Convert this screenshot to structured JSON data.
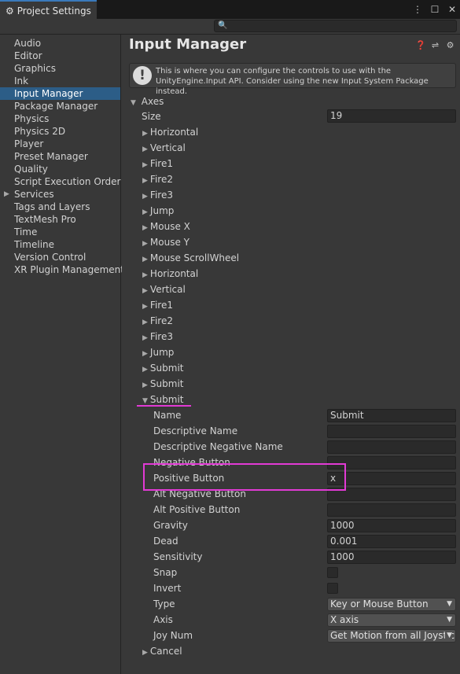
{
  "window": {
    "tab_label": "Project Settings",
    "tab_icon": "gear-icon"
  },
  "search": {
    "placeholder": ""
  },
  "sidebar": {
    "items": [
      {
        "label": "Audio"
      },
      {
        "label": "Editor"
      },
      {
        "label": "Graphics"
      },
      {
        "label": "Ink"
      },
      {
        "label": "Input Manager",
        "selected": true
      },
      {
        "label": "Package Manager"
      },
      {
        "label": "Physics"
      },
      {
        "label": "Physics 2D"
      },
      {
        "label": "Player"
      },
      {
        "label": "Preset Manager"
      },
      {
        "label": "Quality"
      },
      {
        "label": "Script Execution Order"
      },
      {
        "label": "Services",
        "expandable": true
      },
      {
        "label": "Tags and Layers"
      },
      {
        "label": "TextMesh Pro"
      },
      {
        "label": "Time"
      },
      {
        "label": "Timeline"
      },
      {
        "label": "Version Control"
      },
      {
        "label": "XR Plugin Management"
      }
    ]
  },
  "main": {
    "title": "Input Manager",
    "help_text": "This is where you can configure the controls to use with the UnityEngine.Input API. Consider using the new Input System Package instead.",
    "axes_label": "Axes",
    "size_label": "Size",
    "size_value": "19",
    "axes": [
      "Horizontal",
      "Vertical",
      "Fire1",
      "Fire2",
      "Fire3",
      "Jump",
      "Mouse X",
      "Mouse Y",
      "Mouse ScrollWheel",
      "Horizontal",
      "Vertical",
      "Fire1",
      "Fire2",
      "Fire3",
      "Jump",
      "Submit",
      "Submit",
      "Submit",
      "Cancel"
    ],
    "expanded_axis": {
      "name_label": "Name",
      "name_value": "Submit",
      "descriptive_name_label": "Descriptive Name",
      "descriptive_name_value": "",
      "descriptive_negative_name_label": "Descriptive Negative Name",
      "descriptive_negative_name_value": "",
      "negative_button_label": "Negative Button",
      "negative_button_value": "",
      "positive_button_label": "Positive Button",
      "positive_button_value": "x",
      "alt_negative_button_label": "Alt Negative Button",
      "alt_negative_button_value": "",
      "alt_positive_button_label": "Alt Positive Button",
      "alt_positive_button_value": "",
      "gravity_label": "Gravity",
      "gravity_value": "1000",
      "dead_label": "Dead",
      "dead_value": "0.001",
      "sensitivity_label": "Sensitivity",
      "sensitivity_value": "1000",
      "snap_label": "Snap",
      "snap_checked": false,
      "invert_label": "Invert",
      "invert_checked": false,
      "type_label": "Type",
      "type_value": "Key or Mouse Button",
      "axis_label": "Axis",
      "axis_value": "X axis",
      "joy_num_label": "Joy Num",
      "joy_num_value": "Get Motion from all Joysticks"
    }
  },
  "colors": {
    "selection": "#2c5d87",
    "annotation": "#e23ad5",
    "tab_accent": "#3a79bb"
  }
}
